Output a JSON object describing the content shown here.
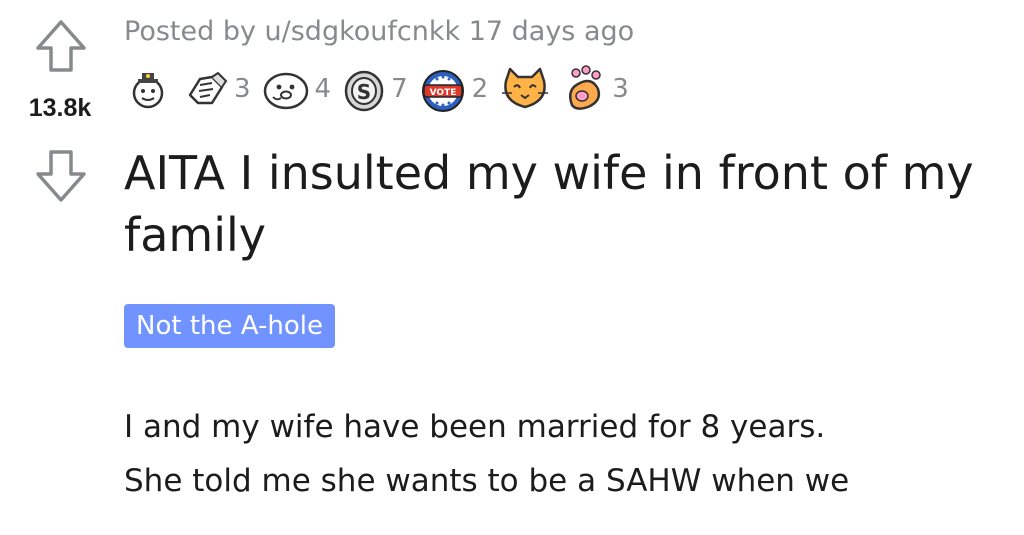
{
  "post": {
    "score": "13.8k",
    "meta": {
      "prefix": "Posted by ",
      "username": "u/sdgkoufcnkk",
      "age": " 17 days ago"
    },
    "awards": [
      {
        "icon": "helpful-award-icon",
        "count": ""
      },
      {
        "icon": "hands-shake-award-icon",
        "count": "3"
      },
      {
        "icon": "wholesome-seal-award-icon",
        "count": "4"
      },
      {
        "icon": "silver-coin-award-icon",
        "count": "7"
      },
      {
        "icon": "vote-badge-award-icon",
        "count": "2"
      },
      {
        "icon": "cat-award-icon",
        "count": ""
      },
      {
        "icon": "paw-award-icon",
        "count": "3"
      }
    ],
    "title": "AITA I insulted my wife in front of my family",
    "flair": "Not the A-hole",
    "body_lines": [
      "I and my wife have been married for 8 years.",
      "She told me she wants to be a SAHW when we"
    ]
  },
  "colors": {
    "meta_gray": "#878a8c",
    "flair_bg": "#7193ff",
    "text": "#1c1c1c"
  }
}
